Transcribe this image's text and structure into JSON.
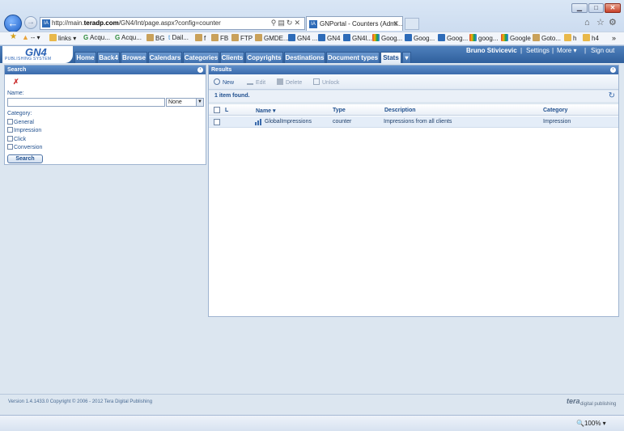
{
  "browser": {
    "address_prefix": "http://main.",
    "address_domain": "teradp.com",
    "address_suffix": "/GN4/Int/page.aspx?config=counter",
    "tab_title": "GNPortal - Counters (Admi...",
    "favicon_text": "IA",
    "zoom": "100%",
    "bookmarks": [
      "links",
      "Acqu...",
      "Acqu...",
      "BG",
      "Dail...",
      "f",
      "FB",
      "FTP",
      "GMDE...",
      "GN4 ...",
      "GN4",
      "GN4l...",
      "Goog...",
      "Goog...",
      "Goog...",
      "goog...",
      "Google",
      "Goto...",
      "h",
      "h4"
    ]
  },
  "app": {
    "logo": "GN4",
    "logo_sub": "PUBLISHING SYSTEM",
    "nav_tabs": [
      "Home",
      "Back4",
      "Browse",
      "Calendars",
      "Categories",
      "Clients",
      "Copyrights",
      "Destinations",
      "Document types",
      "Stats"
    ],
    "active_tab": "Stats",
    "user_name": "Bruno Stivicevic",
    "settings_label": "Settings",
    "more_label": "More",
    "signout_label": "Sign out",
    "separator": "|"
  },
  "search": {
    "title": "Search",
    "name_label": "Name:",
    "name_value": "",
    "match_value": "None",
    "category_label": "Category:",
    "categories": [
      "General",
      "Impression",
      "Click",
      "Conversion"
    ],
    "button_label": "Search"
  },
  "results": {
    "title": "Results",
    "toolbar": {
      "new": "New",
      "edit": "Edit",
      "delete": "Delete",
      "unlock": "Unlock"
    },
    "status": "1 item found.",
    "columns": {
      "lock": "L",
      "name": "Name",
      "type": "Type",
      "description": "Description",
      "category": "Category"
    },
    "rows": [
      {
        "name": "GlobalImpressions",
        "type": "counter",
        "description": "Impressions from all clients",
        "category": "Impression"
      }
    ]
  },
  "footer": {
    "copyright": "Version 1.4.1433.0 Copyright © 2006 - 2012 Tera Digital Publishing",
    "tera": "tera",
    "tera_sub": "digital publishing"
  }
}
